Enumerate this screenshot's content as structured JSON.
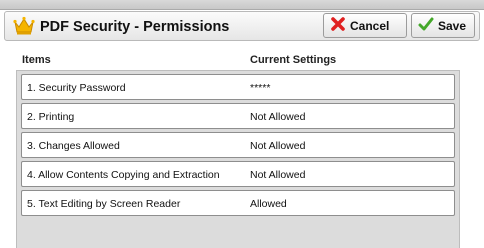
{
  "title_bar": {
    "title": "PDF Security - Permissions",
    "icon": "crown-icon",
    "cancel_label": "Cancel",
    "save_label": "Save"
  },
  "table": {
    "headers": {
      "items": "Items",
      "current_settings": "Current Settings"
    },
    "rows": [
      {
        "item": "1. Security Password",
        "value": "*****"
      },
      {
        "item": "2. Printing",
        "value": "Not Allowed"
      },
      {
        "item": "3. Changes Allowed",
        "value": "Not Allowed"
      },
      {
        "item": "4. Allow Contents Copying and Extraction",
        "value": "Not Allowed"
      },
      {
        "item": "5. Text Editing by Screen Reader",
        "value": "Allowed"
      }
    ]
  },
  "colors": {
    "cancel_icon": "#e02020",
    "save_icon": "#44a82a",
    "crown_icon": "#f5b400",
    "panel_background": "#dcdcdc"
  }
}
